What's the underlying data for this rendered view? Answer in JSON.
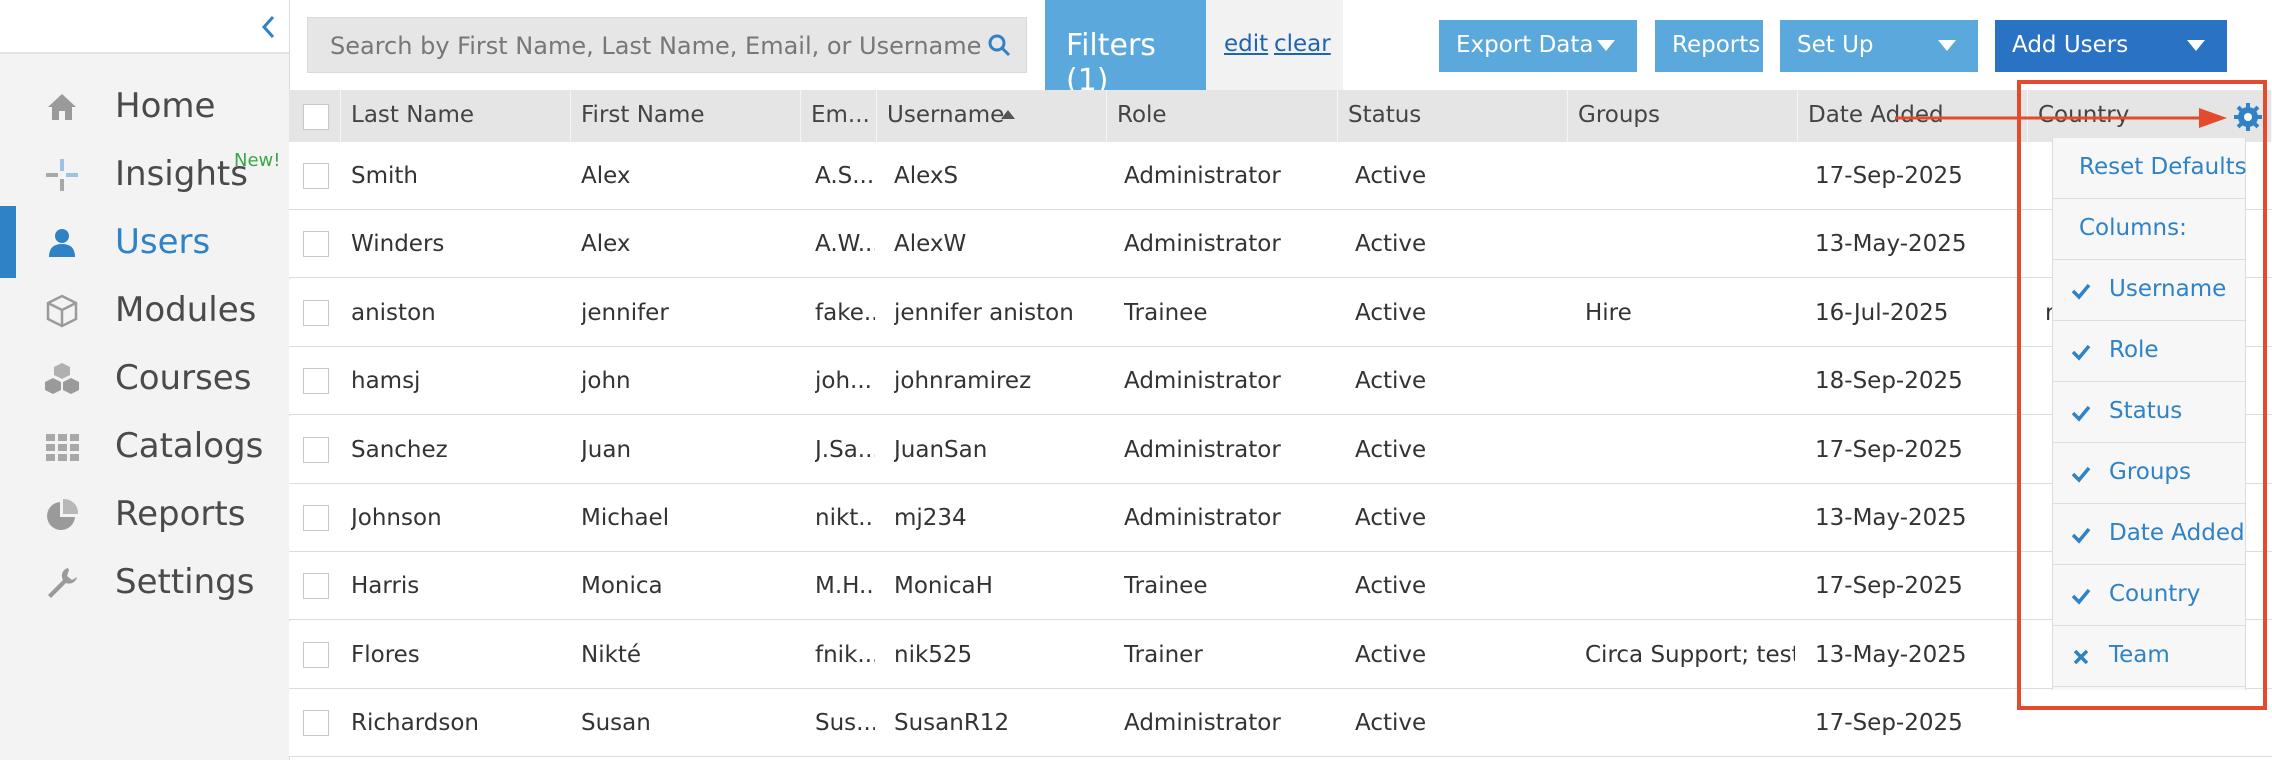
{
  "sidebar": {
    "items": [
      {
        "label": "Home",
        "icon": "home-icon",
        "badge": ""
      },
      {
        "label": "Insights",
        "icon": "insights-icon",
        "badge": "New!"
      },
      {
        "label": "Users",
        "icon": "user-icon",
        "badge": "",
        "active": true
      },
      {
        "label": "Modules",
        "icon": "cube-icon",
        "badge": ""
      },
      {
        "label": "Courses",
        "icon": "cubes-icon",
        "badge": ""
      },
      {
        "label": "Catalogs",
        "icon": "grid-icon",
        "badge": ""
      },
      {
        "label": "Reports",
        "icon": "pie-chart-icon",
        "badge": ""
      },
      {
        "label": "Settings",
        "icon": "wrench-icon",
        "badge": ""
      }
    ]
  },
  "toolbar": {
    "search_placeholder": "Search by First Name, Last Name, Email, or Username",
    "filters_label": "Filters (1)",
    "edit_label": "edit",
    "clear_label": "clear",
    "export_label": "Export Data",
    "reports_label": "Reports",
    "setup_label": "Set Up",
    "add_users_label": "Add Users"
  },
  "table": {
    "headers": {
      "last_name": "Last Name",
      "first_name": "First Name",
      "email": "Em...",
      "username": "Username",
      "role": "Role",
      "status": "Status",
      "groups": "Groups",
      "date_added": "Date Added",
      "country": "Country"
    },
    "rows": [
      {
        "last": "Smith",
        "first": "Alex",
        "email": "A.S...",
        "username": "AlexS",
        "role": "Administrator",
        "status": "Active",
        "groups": "",
        "date": "17-Sep-2025",
        "country": ""
      },
      {
        "last": "Winders",
        "first": "Alex",
        "email": "A.W...",
        "username": "AlexW",
        "role": "Administrator",
        "status": "Active",
        "groups": "",
        "date": "13-May-2025",
        "country": ""
      },
      {
        "last": "aniston",
        "first": "jennifer",
        "email": "fake...",
        "username": "jennifer aniston",
        "role": "Trainee",
        "status": "Active",
        "groups": "Hire",
        "date": "16-Jul-2025",
        "country": "r"
      },
      {
        "last": "hamsj",
        "first": "john",
        "email": "joh...",
        "username": "johnramirez",
        "role": "Administrator",
        "status": "Active",
        "groups": "",
        "date": "18-Sep-2025",
        "country": ""
      },
      {
        "last": "Sanchez",
        "first": "Juan",
        "email": "J.Sa...",
        "username": "JuanSan",
        "role": "Administrator",
        "status": "Active",
        "groups": "",
        "date": "17-Sep-2025",
        "country": ""
      },
      {
        "last": "Johnson",
        "first": "Michael",
        "email": "nikt...",
        "username": "mj234",
        "role": "Administrator",
        "status": "Active",
        "groups": "",
        "date": "13-May-2025",
        "country": ""
      },
      {
        "last": "Harris",
        "first": "Monica",
        "email": "M.H...",
        "username": "MonicaH",
        "role": "Trainee",
        "status": "Active",
        "groups": "",
        "date": "17-Sep-2025",
        "country": ""
      },
      {
        "last": "Flores",
        "first": "Nikté",
        "email": "fnik...",
        "username": "nik525",
        "role": "Trainer",
        "status": "Active",
        "groups": "Circa Support; test ...",
        "date": "13-May-2025",
        "country": ""
      },
      {
        "last": "Richardson",
        "first": "Susan",
        "email": "Sus...",
        "username": "SusanR12",
        "role": "Administrator",
        "status": "Active",
        "groups": "",
        "date": "17-Sep-2025",
        "country": ""
      }
    ]
  },
  "column_menu": {
    "reset_label": "Reset Defaults",
    "columns_label": "Columns:",
    "items": [
      {
        "label": "Username",
        "state": "checked"
      },
      {
        "label": "Role",
        "state": "checked"
      },
      {
        "label": "Status",
        "state": "checked"
      },
      {
        "label": "Groups",
        "state": "checked"
      },
      {
        "label": "Date Added",
        "state": "checked"
      },
      {
        "label": "Country",
        "state": "checked"
      },
      {
        "label": "Team",
        "state": "unchecked"
      }
    ]
  },
  "colors": {
    "accent": "#2f82c6",
    "button": "#5ba8dc",
    "primary_button": "#2a72c4",
    "annotation": "#e44a2e"
  }
}
